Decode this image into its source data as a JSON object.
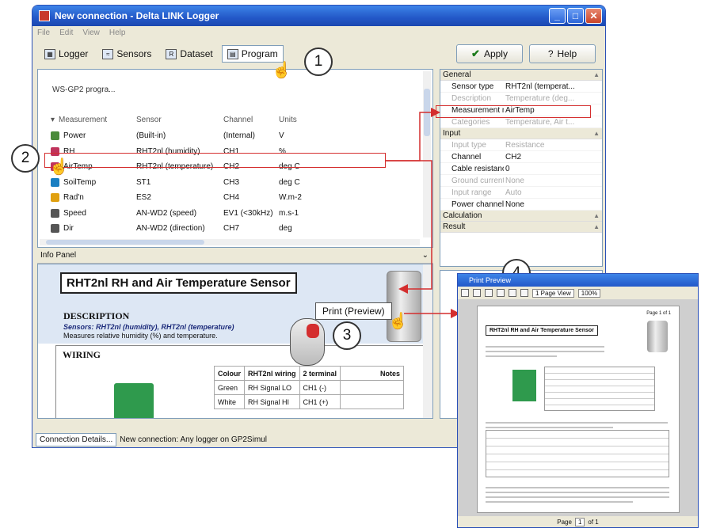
{
  "window": {
    "title": "New connection - Delta LINK Logger",
    "menu": [
      "File",
      "Edit",
      "View",
      "Help"
    ]
  },
  "toolbar": {
    "tabs": [
      {
        "label": "Logger",
        "icon": "logger-icon"
      },
      {
        "label": "Sensors",
        "icon": "sensors-icon"
      },
      {
        "label": "Dataset",
        "icon": "dataset-icon"
      },
      {
        "label": "Program",
        "icon": "program-icon",
        "active": true
      }
    ],
    "apply": "Apply",
    "help": "Help"
  },
  "program_row": "WS-GP2 progra...",
  "table": {
    "headers": [
      "Measurement",
      "Sensor",
      "Channel",
      "Units"
    ],
    "rows": [
      {
        "name": "Power",
        "sensor": "(Built-in)",
        "channel": "(Internal)",
        "units": "V",
        "icon_color": "#4a8b3a"
      },
      {
        "name": "RH",
        "sensor": "RHT2nl (humidity)",
        "channel": "CH1",
        "units": "%",
        "icon_color": "#c0335c"
      },
      {
        "name": "AirTemp",
        "sensor": "RHT2nl (temperature)",
        "channel": "CH2",
        "units": "deg C",
        "icon_color": "#c0335c"
      },
      {
        "name": "SoilTemp",
        "sensor": "ST1",
        "channel": "CH3",
        "units": "deg C",
        "icon_color": "#1a7fc2"
      },
      {
        "name": "Rad'n",
        "sensor": "ES2",
        "channel": "CH4",
        "units": "W.m-2",
        "icon_color": "#e0a010"
      },
      {
        "name": "Speed",
        "sensor": "AN-WD2 (speed)",
        "channel": "EV1 (<30kHz)",
        "units": "m.s-1",
        "icon_color": "#555555"
      },
      {
        "name": "Dir",
        "sensor": "AN-WD2 (direction)",
        "channel": "CH7",
        "units": "deg",
        "icon_color": "#555555"
      }
    ]
  },
  "properties": {
    "groups": [
      {
        "title": "General",
        "rows": [
          {
            "name": "Sensor type",
            "value": "RHT2nl (temperat...",
            "muted": false
          },
          {
            "name": "Description",
            "value": "Temperature (deg...",
            "muted": true
          },
          {
            "name": "Measurement n",
            "value": "AirTemp",
            "muted": false
          },
          {
            "name": "Categories",
            "value": "Temperature, Air t...",
            "muted": true
          }
        ]
      },
      {
        "title": "Input",
        "rows": [
          {
            "name": "Input type",
            "value": "Resistance",
            "muted": true
          },
          {
            "name": "Channel",
            "value": "CH2",
            "muted": false
          },
          {
            "name": "Cable resistanc",
            "value": "0",
            "muted": false
          },
          {
            "name": "Ground current",
            "value": "None",
            "muted": true
          },
          {
            "name": "Input range",
            "value": "Auto",
            "muted": true
          },
          {
            "name": "Power channel",
            "value": "None",
            "muted": false
          }
        ]
      },
      {
        "title": "Calculation",
        "rows": []
      },
      {
        "title": "Result",
        "rows": []
      }
    ]
  },
  "info": {
    "panel_title": "Info Panel",
    "heading": "RHT2nl RH and Air Temperature Sensor",
    "description_title": "DESCRIPTION",
    "sensors_line": "Sensors: RHT2nl (humidity), RHT2nl (temperature)",
    "description_text": "Measures relative humidity (%) and temperature.",
    "wiring_title": "WIRING",
    "wiring_headers": [
      "Colour",
      "RHT2nl wiring",
      "2 terminal",
      "Notes"
    ],
    "wiring_rows": [
      [
        "Green",
        "RH Signal LO",
        "CH1 (-)",
        ""
      ],
      [
        "White",
        "RH Signal HI",
        "CH1 (+)",
        ""
      ]
    ]
  },
  "popup": {
    "print_preview": "Print (Preview)"
  },
  "status": {
    "button": "Connection Details...",
    "text": "New connection: Any logger on GP2Simul"
  },
  "callouts": [
    "1",
    "2",
    "3",
    "4"
  ],
  "preview": {
    "title": "Print Preview",
    "view_mode": "1 Page View",
    "zoom": "100%",
    "page_label": "Page 1 of 1",
    "heading": "RHT2nl RH and Air Temperature Sensor",
    "footer_page": "1",
    "footer_of": "of 1"
  },
  "colors": {
    "accent": "#d42e2e",
    "titlebar": "#2358c8"
  }
}
